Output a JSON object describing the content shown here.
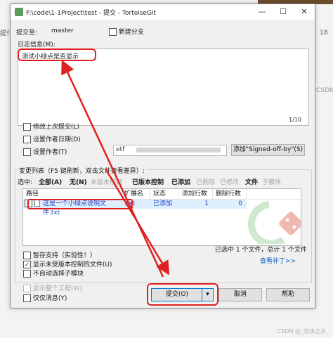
{
  "background": {
    "left_text": "提代",
    "right_text": "CSDN",
    "right_text_top": "18",
    "watermark": "CSDN @_泡沫之水_"
  },
  "window": {
    "title": "F:\\code\\1-1Project\\test - 提交 - TortoiseGit",
    "controls": {
      "minimize": "—",
      "maximize": "☐",
      "close": "✕"
    }
  },
  "commit_to": {
    "label": "提交至:",
    "branch": "master",
    "new_branch_label": "新建分支"
  },
  "log": {
    "group_label": "日志信息(M):",
    "message": "测试小绿点是否显示",
    "position": "1/10"
  },
  "options": {
    "amend_label": "修改上次提交(L)",
    "set_date_label": "设置作者日期(D)",
    "set_author_label": "设置作者(T)",
    "author_value": "etf",
    "signed_off_button": "添加\"Signed-off-by\"(S)"
  },
  "changes": {
    "group_label": "变更列表（F5 键刷新，双击文件查看差异）:",
    "select_label": "选中:",
    "filters": [
      {
        "label": "全部(A)",
        "bold": true,
        "enabled": true
      },
      {
        "label": "无(N)",
        "bold": true,
        "enabled": true
      },
      {
        "label": "未版本控制",
        "bold": false,
        "enabled": false
      },
      {
        "label": "已版本控制",
        "bold": true,
        "enabled": true
      },
      {
        "label": "已添加",
        "bold": true,
        "enabled": true
      },
      {
        "label": "已删除",
        "bold": false,
        "enabled": false
      },
      {
        "label": "已修改",
        "bold": false,
        "enabled": false
      },
      {
        "label": "文件",
        "bold": true,
        "enabled": true
      },
      {
        "label": "子模块",
        "bold": false,
        "enabled": false
      }
    ],
    "columns": [
      "路径",
      "扩展名",
      "状态",
      "添加行数",
      "删除行数"
    ],
    "rows": [
      {
        "path": "这是一个小绿点说明文件.txt",
        "ext": ".txt",
        "status": "已添加",
        "added": "1",
        "deleted": "0"
      }
    ],
    "summary": "已选中 1 个文件，总计 1 个文件",
    "view_patch": "查看补丁>>"
  },
  "bottom_options": {
    "stash_label": "暂存支持（实验性！）",
    "show_unversioned_label": "显示未受版本控制的文件(U)",
    "no_auto_submodule_label": "不自动选择子模块",
    "show_whole_project_label": "显示整个工程(W)",
    "message_only_label": "仅仅消息(Y)"
  },
  "buttons": {
    "commit": "提交(O)",
    "dropdown": "▾",
    "cancel": "取消",
    "help": "帮助"
  },
  "colors": {
    "annotation_red": "#e02020",
    "link_blue": "#0b5fbf",
    "added_status": "#1e3fbf"
  }
}
